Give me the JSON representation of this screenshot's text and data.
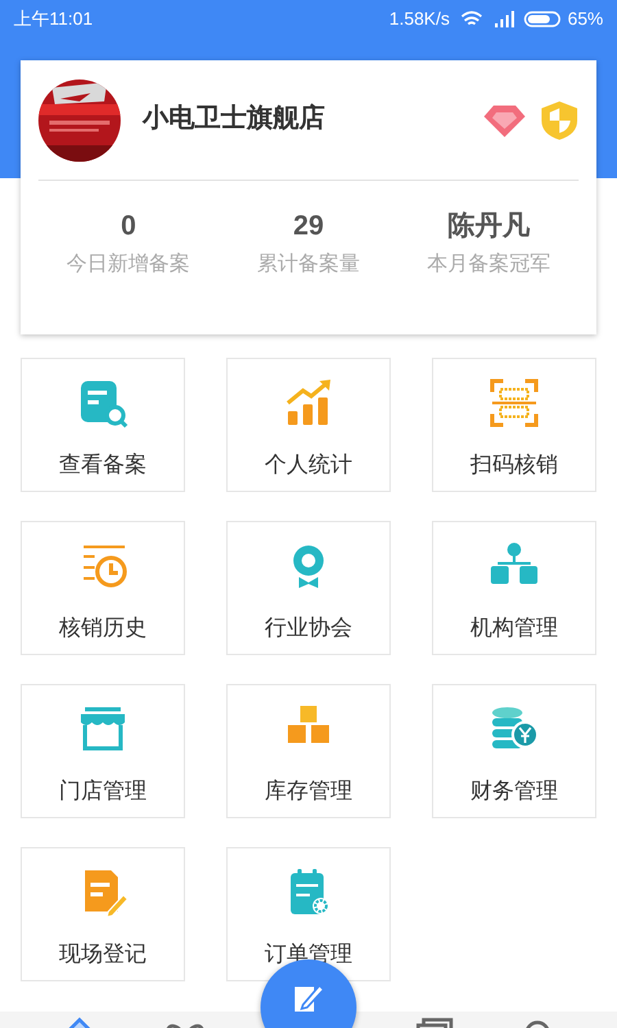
{
  "status_bar": {
    "time": "上午11:01",
    "speed": "1.58K/s",
    "battery": "65%"
  },
  "shop": {
    "name": "小电卫士旗舰店"
  },
  "stats": [
    {
      "value": "0",
      "label": "今日新增备案"
    },
    {
      "value": "29",
      "label": "累计备案量"
    },
    {
      "value": "陈丹凡",
      "label": "本月备案冠军"
    }
  ],
  "tiles": [
    {
      "label": "查看备案"
    },
    {
      "label": "个人统计"
    },
    {
      "label": "扫码核销"
    },
    {
      "label": "核销历史"
    },
    {
      "label": "行业协会"
    },
    {
      "label": "机构管理"
    },
    {
      "label": "门店管理"
    },
    {
      "label": "库存管理"
    },
    {
      "label": "财务管理"
    },
    {
      "label": "现场登记"
    },
    {
      "label": "订单管理"
    }
  ],
  "bottom_nav": [
    {
      "selected": true
    },
    {
      "selected": false
    },
    {
      "selected": false
    },
    {
      "selected": false
    }
  ]
}
